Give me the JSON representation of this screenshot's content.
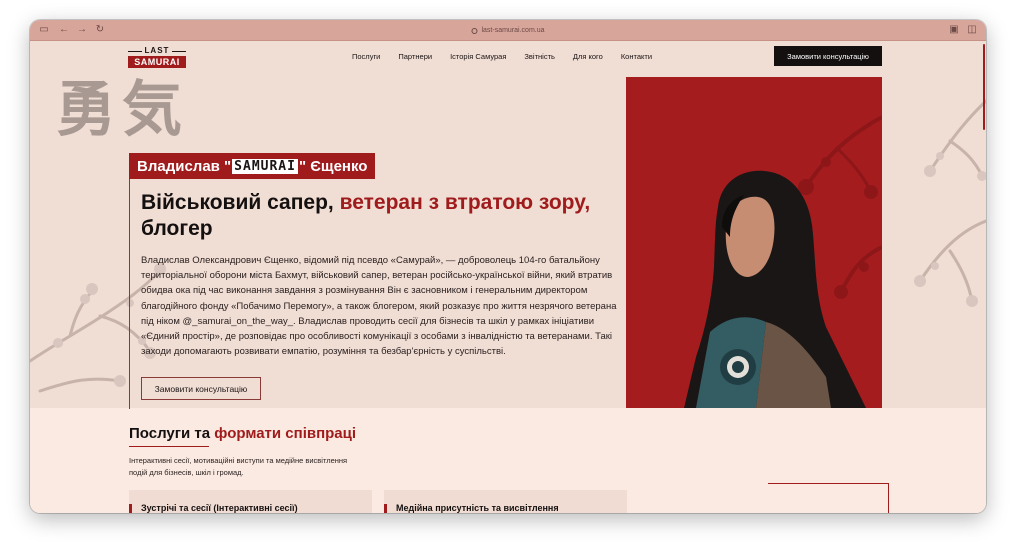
{
  "browser": {
    "url": "last-samurai.com.ua"
  },
  "header": {
    "logo_top": "LAST",
    "logo_bottom": "SAMURAI",
    "nav": [
      {
        "label": "Послуги"
      },
      {
        "label": "Партнери"
      },
      {
        "label": "Історія Самурая"
      },
      {
        "label": "Звітність"
      },
      {
        "label": "Для кого"
      },
      {
        "label": "Контакти"
      }
    ],
    "cta_label": "Замовити консультацію"
  },
  "hero": {
    "kanji": "勇気",
    "name_first": "Владислав \"",
    "name_nick": "SAMURAI",
    "name_last": "\" Єщенко",
    "headline_black_1": "Військовий сапер, ",
    "headline_red": "ветеран з втратою зору, ",
    "headline_black_2": " блогер",
    "bio": "Владислав Олександрович Єщенко, відомий під псевдо «Самурай», — доброволець 104-го батальйону територіальної оборони міста Бахмут, військовий сапер, ветеран російсько-української війни, який втратив обидва ока під час виконання завдання з розмінування Він є засновником і генеральним директором благодійного фонду «Побачимо Перемогу», а також блогером, який розказує про життя незрячого ветерана під ніком @_samurai_on_the_way_. Владислав проводить сесії для бізнесів та шкіл у рамках ініціативи «Єдиний простір», де розповідає про особливості комунікації з особами з інвалідністю та ветеранами. Такі заходи допомагають розвивати емпатію, розуміння та безбар'єрність у суспільстві.",
    "cta_label": "Замовити консультацію"
  },
  "services": {
    "title_black": "Послуги та ",
    "title_red": "формати співпраці",
    "subtitle": "Інтерактивні сесії, мотиваційні виступи та медійне висвітлення подій для бізнесів, шкіл і громад.",
    "cards": [
      {
        "label": "Зустрічі та сесії (Інтерактивні сесії)"
      },
      {
        "label": "Медійна присутність та висвітлення"
      }
    ]
  },
  "colors": {
    "accent": "#a01c1c",
    "dark": "#141010",
    "page_bg": "#fbeae2",
    "chrome_bg": "#d8a59b"
  }
}
